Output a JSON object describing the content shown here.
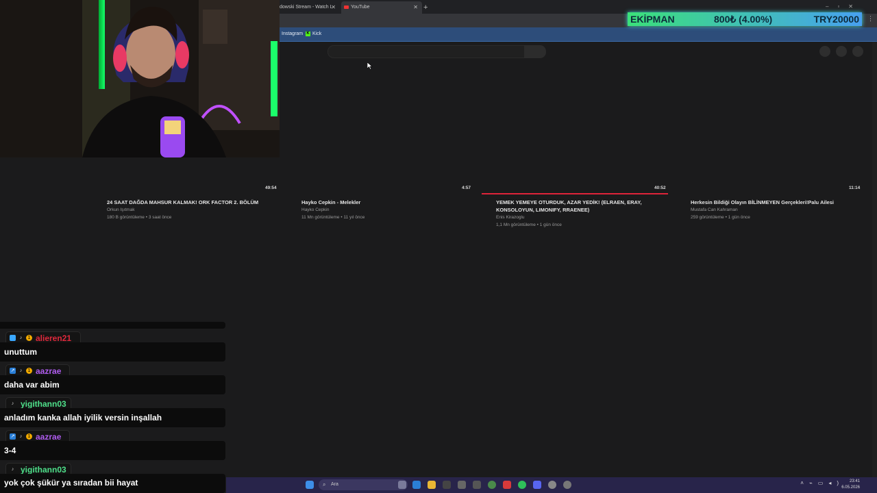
{
  "browser": {
    "tabs": [
      {
        "label": "dowski Stream - Watch L"
      },
      {
        "label": "YouTube"
      }
    ],
    "new_tab": "+",
    "window_controls": "–▫✕",
    "bookmarks": [
      {
        "label": "Instagram"
      },
      {
        "label": "Kick"
      }
    ],
    "kick_letter": "K"
  },
  "overlay": {
    "name": "EKİPMAN",
    "amount": "800₺ (4.00%)",
    "goal": "TRY20000"
  },
  "videos": [
    {
      "duration": "49:54",
      "title": "24 SAAT DAĞDA MAHSUR KALMAK! ORK FACTOR 2. BÖLÜM",
      "channel": "Orkun Işıtmak",
      "meta": "180 B görüntüleme • 3 saat önce"
    },
    {
      "duration": "4:57",
      "title": "Hayko Cepkin - Melekler",
      "channel": "Hayko Cepkin",
      "meta": "11 Mn görüntüleme • 11 yıl önce"
    },
    {
      "duration": "40:52",
      "title": "YEMEK YEMEYE OTURDUK, AZAR YEDİK! (ELRAEN, ERAY, KONSOLOYUN, LIMONIFY, RRAENEE)",
      "channel": "Enis Kirazoglu",
      "meta": "1,1 Mn görüntüleme • 1 gün önce"
    },
    {
      "duration": "11:14",
      "title": "Herkesin Bildiği Olayın BİLİNMEYEN Gerçekleri!Palu Ailesi",
      "channel": "Mustafa Can Kahraman",
      "meta": "259 görüntüleme • 1 gün önce"
    }
  ],
  "chat": [
    {
      "user": "alieren21",
      "color": "#e0283c",
      "message": "unuttum",
      "badges": [
        "cube-badge-icon",
        "note-badge-icon",
        "one-badge-icon"
      ]
    },
    {
      "user": "aazrae",
      "color": "#b05cf0",
      "message": "daha var abim",
      "badges": [
        "arrow-badge-icon",
        "note-badge-icon",
        "one-badge-icon"
      ]
    },
    {
      "user": "yigithann03",
      "color": "#4ee08a",
      "message": "anladım kanka allah iyilik versin inşallah",
      "badges": [
        "note-badge-icon"
      ]
    },
    {
      "user": "aazrae",
      "color": "#b05cf0",
      "message": "3-4",
      "badges": [
        "arrow-badge-icon",
        "note-badge-icon",
        "one-badge-icon"
      ]
    },
    {
      "user": "yigithann03",
      "color": "#4ee08a",
      "message": "yok çok şükür ya sıradan bii hayat",
      "badges": [
        "note-badge-icon"
      ]
    }
  ],
  "taskbar": {
    "search_placeholder": "Ara",
    "time": "23:41",
    "date": "6.05.2026"
  },
  "colors": {
    "accent_red": "#e0243a",
    "banner_green": "#3be07a",
    "banner_blue": "#47a0f0"
  }
}
